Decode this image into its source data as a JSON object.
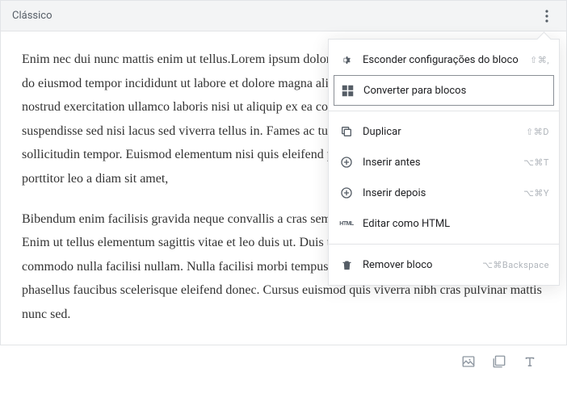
{
  "block": {
    "title": "Clássico",
    "paragraphs": [
      "Enim nec dui nunc mattis enim ut tellus.Lorem ipsum dolor sit amet, consectetur adipiscing elit, sed do eiusmod tempor incididunt ut labore et dolore magna aliqua. Ut enim ad minim veniam, quis nostrud exercitation ullamco laboris nisi ut aliquip ex ea commodo consequat. Potenti nullam ac suspendisse sed nisi lacus sed viverra tellus in. Fames ac turpis egestas porttitor leo a diam sollicitudin tempor. Euismod elementum nisi quis eleifend placerat duis ultricies lacus. Lorem ipsum porttitor leo a diam sit amet,",
      "Bibendum enim facilisis gravida neque convallis a cras semper. Ultricies elit elementum eu facilisis. Enim ut tellus elementum sagittis vitae et leo duis ut. Duis tristique sollicitudin nibh sit amet commodo nulla facilisi nullam. Nulla facilisi morbi tempus iaculis. Egestas egestas fringilla phasellus faucibus scelerisque eleifend donec. Cursus euismod quis viverra nibh cras pulvinar mattis nunc sed."
    ]
  },
  "menu": {
    "hide_settings": {
      "label": "Esconder configurações do bloco",
      "shortcut": "⇧⌘,"
    },
    "convert": {
      "label": "Converter para blocos"
    },
    "duplicate": {
      "label": "Duplicar",
      "shortcut": "⇧⌘D"
    },
    "insert_before": {
      "label": "Inserir antes",
      "shortcut": "⌥⌘T"
    },
    "insert_after": {
      "label": "Inserir depois",
      "shortcut": "⌥⌘Y"
    },
    "edit_html": {
      "label": "Editar como HTML"
    },
    "remove": {
      "label": "Remover bloco",
      "shortcut": "⌥⌘Backspace"
    }
  }
}
